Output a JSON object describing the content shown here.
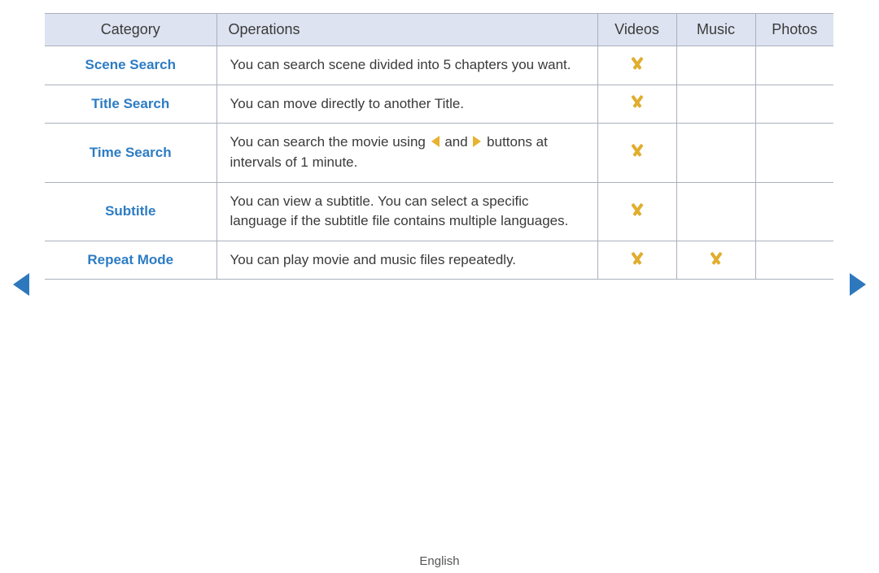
{
  "nav": {
    "prev_icon": "triangle-left-icon",
    "next_icon": "triangle-right-icon",
    "arrow_color": "#2d78bd"
  },
  "table": {
    "headers": {
      "category": "Category",
      "operations": "Operations",
      "videos": "Videos",
      "music": "Music",
      "photos": "Photos"
    },
    "header_bg": "#dde3f0",
    "border_color": "#aab0bd",
    "category_color": "#2d7cc4",
    "mark_color": "#e0ad2e",
    "mark_icon": "chevron-down-icon",
    "rows": [
      {
        "category": "Scene Search",
        "operations": "You can search scene divided into 5 chapters you want.",
        "videos": true,
        "music": false,
        "photos": false
      },
      {
        "category": "Title Search",
        "operations": "You can move directly to another Title.",
        "videos": true,
        "music": false,
        "photos": false
      },
      {
        "category": "Time Search",
        "operations_part1": "You can search the movie using",
        "operations_part2": "and",
        "operations_part3": "buttons at intervals of 1 minute.",
        "inline_icons": [
          "triangle-left-icon",
          "triangle-right-icon"
        ],
        "inline_icon_color": "#e8b230",
        "videos": true,
        "music": false,
        "photos": false
      },
      {
        "category": "Subtitle",
        "operations": "You can view a subtitle. You can select a specific language if the subtitle file contains multiple languages.",
        "videos": true,
        "music": false,
        "photos": false
      },
      {
        "category": "Repeat Mode",
        "operations": "You can play movie and music files repeatedly.",
        "videos": true,
        "music": true,
        "photos": false
      }
    ]
  },
  "footer": {
    "language": "English"
  }
}
